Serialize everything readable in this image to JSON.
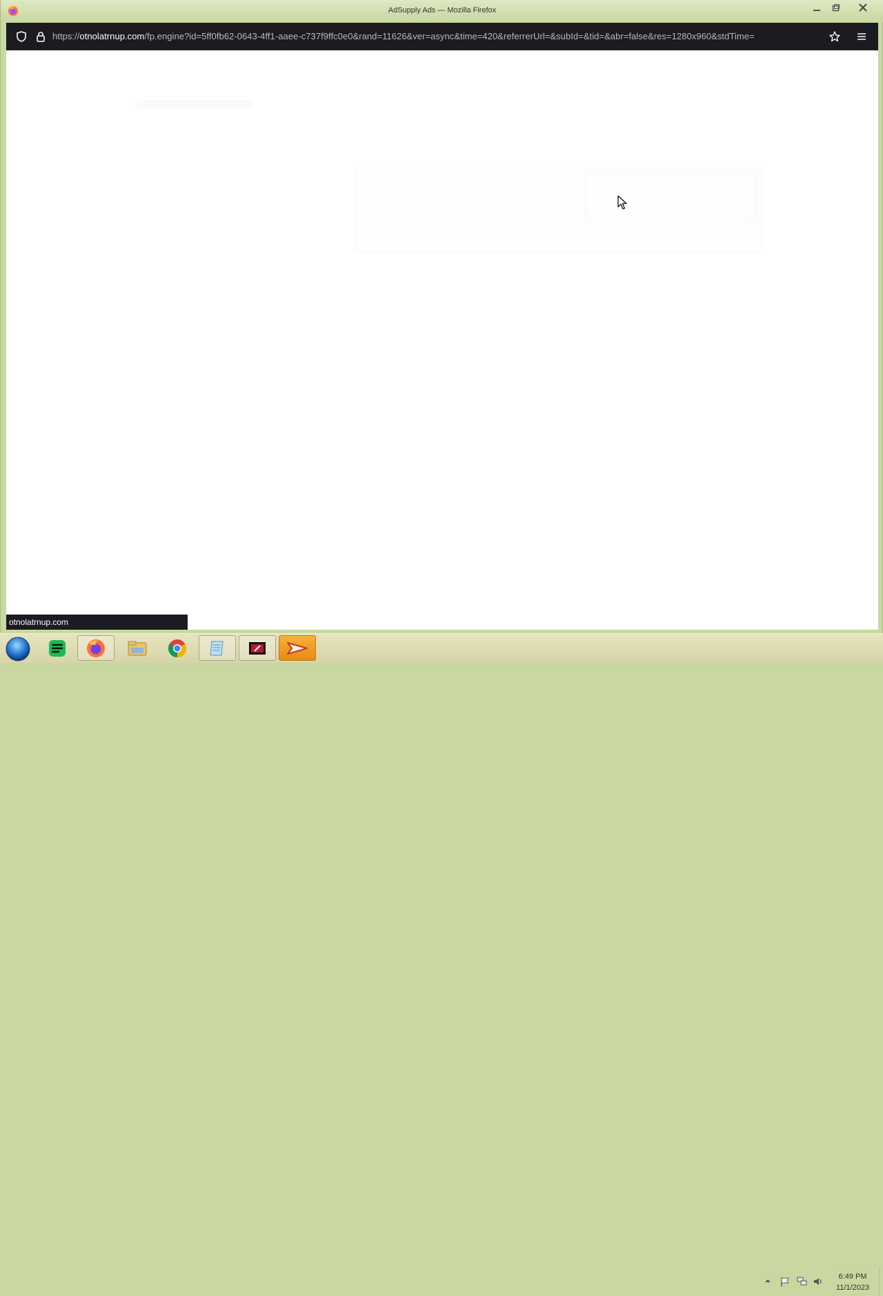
{
  "window": {
    "title": "AdSupply Ads — Mozilla Firefox"
  },
  "navbar": {
    "url_scheme": "https://",
    "url_domain": "otnolatrnup.com",
    "url_rest": "/fp.engine?id=5ff0fb62-0643-4ff1-aaee-c737f9ffc0e0&rand=11626&ver=async&time=420&referrerUrl=&subId=&tid=&abr=false&res=1280x960&stdTime="
  },
  "status": {
    "link_preview": "otnolatrnup.com"
  },
  "taskbar": {
    "apps": [
      {
        "name": "spotify-icon"
      },
      {
        "name": "firefox-icon"
      },
      {
        "name": "file-explorer-icon"
      },
      {
        "name": "chrome-icon"
      },
      {
        "name": "notepad-icon"
      },
      {
        "name": "media-app-icon"
      },
      {
        "name": "adsupply-app-icon"
      }
    ],
    "clock_time": "6:49 PM",
    "clock_date": "11/1/2023"
  },
  "colors": {
    "taskbar": "#d8d4a8",
    "navbar": "#1c1b22",
    "accent_orange": "#e58a12"
  }
}
